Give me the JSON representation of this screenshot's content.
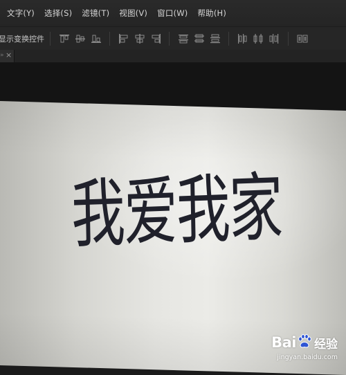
{
  "menubar": {
    "items": [
      "文字(Y)",
      "选择(S)",
      "滤镜(T)",
      "视图(V)",
      "窗口(W)",
      "帮助(H)"
    ]
  },
  "optionsbar": {
    "label": "显示变换控件",
    "align_icons": [
      "align-top-edges-icon",
      "align-vertical-centers-icon",
      "align-bottom-edges-icon",
      "align-left-edges-icon",
      "align-horizontal-centers-icon",
      "align-right-edges-icon",
      "distribute-top-icon",
      "distribute-vertical-centers-icon",
      "distribute-bottom-icon",
      "distribute-left-icon",
      "distribute-horizontal-centers-icon",
      "distribute-right-icon",
      "auto-align-layers-icon"
    ]
  },
  "tab": {
    "arrow": "»",
    "close": "×"
  },
  "canvas": {
    "text": "我爱我家"
  },
  "watermark": {
    "brand": "Bai",
    "suffix": "经验",
    "url": "jingyan.baidu.com"
  },
  "colors": {
    "menubar_bg": "#262626",
    "canvas_text": "#20212b"
  }
}
